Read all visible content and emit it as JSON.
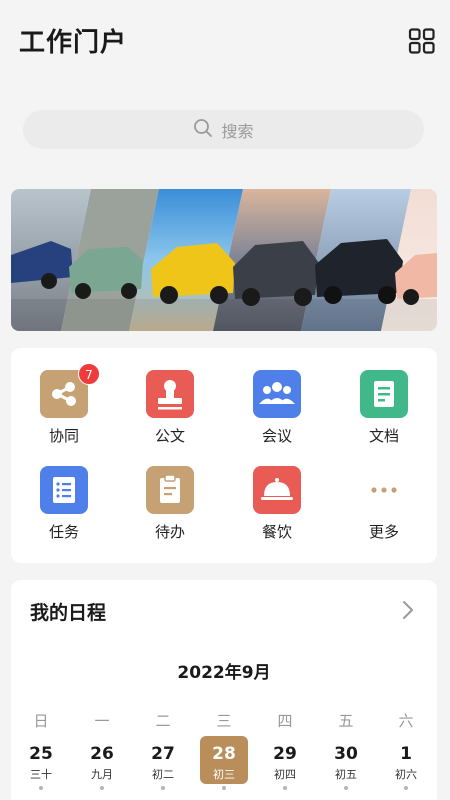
{
  "header": {
    "title": "工作门户"
  },
  "search": {
    "placeholder": "搜索"
  },
  "menu": {
    "items": [
      {
        "label": "协同",
        "badge": "7"
      },
      {
        "label": "公文"
      },
      {
        "label": "会议"
      },
      {
        "label": "文档"
      },
      {
        "label": "任务"
      },
      {
        "label": "待办"
      },
      {
        "label": "餐饮"
      },
      {
        "label": "更多"
      }
    ]
  },
  "schedule": {
    "title": "我的日程",
    "month": "2022年9月",
    "weekdays": [
      "日",
      "一",
      "二",
      "三",
      "四",
      "五",
      "六"
    ],
    "days": [
      {
        "num": "25",
        "lunar": "三十"
      },
      {
        "num": "26",
        "lunar": "九月"
      },
      {
        "num": "27",
        "lunar": "初二"
      },
      {
        "num": "28",
        "lunar": "初三",
        "selected": true
      },
      {
        "num": "29",
        "lunar": "初四"
      },
      {
        "num": "30",
        "lunar": "初五"
      },
      {
        "num": "1",
        "lunar": "初六"
      }
    ]
  },
  "colors": {
    "accent_gold": "#b98e5b",
    "badge_red": "#ef3b3b",
    "icon_red": "#e85c55",
    "icon_blue": "#4f7fe8",
    "icon_green": "#41b88a"
  }
}
